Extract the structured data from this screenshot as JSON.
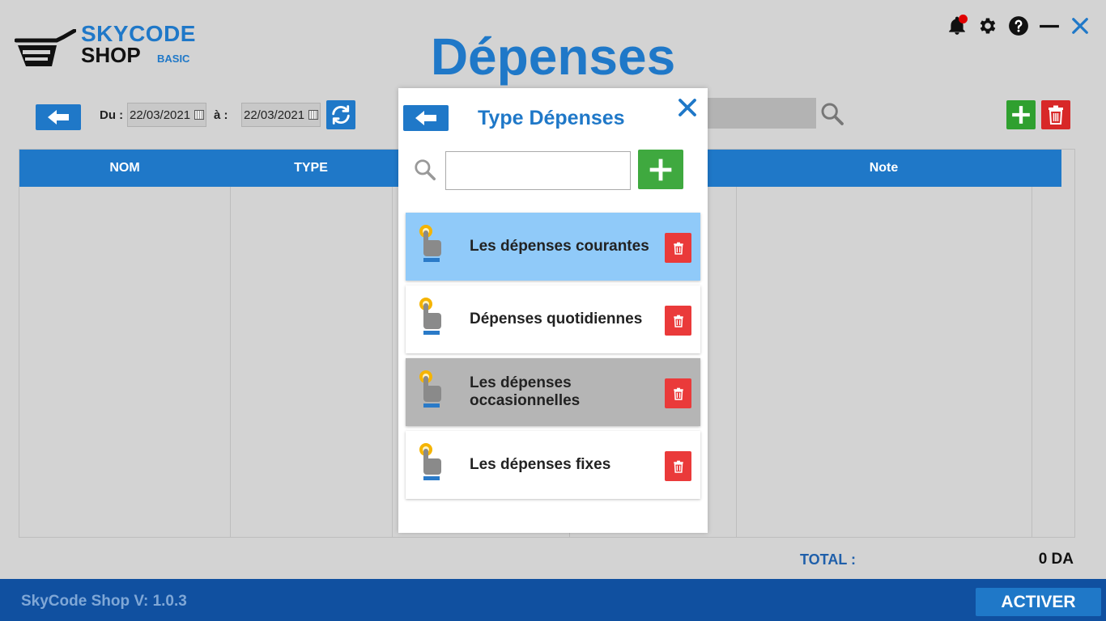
{
  "app": {
    "logo_line1": "SKYCODE",
    "logo_line2": "SHOP",
    "logo_edition": "BASIC",
    "page_title": "Dépenses"
  },
  "toolbar": {
    "from_label": "Du :",
    "from_date": "22/03/2021",
    "to_label": "à :",
    "to_date": "22/03/2021"
  },
  "table": {
    "columns": [
      "NOM",
      "TYPE",
      "Note"
    ]
  },
  "totals": {
    "label": "TOTAL :",
    "value": "0 DA"
  },
  "footer": {
    "version": "SkyCode Shop V: 1.0.3",
    "activate_label": "ACTIVER"
  },
  "modal": {
    "title": "Type Dépenses",
    "search_value": "",
    "items": [
      {
        "label": "Les dépenses courantes",
        "state": "selected"
      },
      {
        "label": "Dépenses quotidiennes",
        "state": "normal"
      },
      {
        "label": "Les dépenses occasionnelles",
        "state": "hover"
      },
      {
        "label": "Les dépenses fixes",
        "state": "normal"
      }
    ]
  },
  "colors": {
    "accent": "#1f78c8",
    "footer": "#1050a0",
    "add_green": "#3fa93f",
    "delete_red": "#ea3a3a",
    "selected_row": "#90caf9",
    "hover_row": "#b5b5b5",
    "notification_dot": "#e00000"
  },
  "icons": [
    "cart-logo-icon",
    "bell-icon",
    "gear-icon",
    "help-icon",
    "minimize-icon",
    "close-icon",
    "arrow-left-icon",
    "calendar-icon",
    "refresh-icon",
    "search-icon",
    "plus-icon",
    "trash-icon",
    "hand-pointer-icon"
  ]
}
